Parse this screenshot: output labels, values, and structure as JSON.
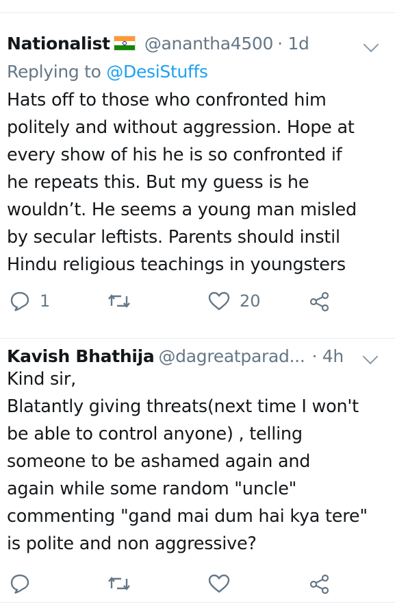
{
  "tweets": [
    {
      "name": "Nationalist",
      "flag": "india-flag-icon",
      "handle": "@anantha4500",
      "time": "· 1d",
      "replying_prefix": "Replying to ",
      "replying_to": "@DesiStuffs",
      "lines": [
        "Hats off to those who confronted him",
        "politely and without aggression. Hope at",
        "every show of his he is so confronted if",
        "he repeats this. But my guess is he",
        "wouldn’t. He seems a young man misled",
        "by secular leftists. Parents should instil",
        "Hindu religious teachings in youngsters"
      ],
      "reply_count": "1",
      "retweet_count": "",
      "like_count": "20"
    },
    {
      "name": "Kavish Bhathija",
      "handle": "@dagreatparad...",
      "time": "· 4h",
      "lines": [
        "Kind sir,",
        "Blatantly giving threats(next time I won't",
        "be able to control anyone) , telling",
        "someone to be ashamed again and",
        "again while some random \"uncle\"",
        "commenting \"gand mai dum hai kya tere\"",
        "is polite and non aggressive?"
      ],
      "reply_count": "",
      "retweet_count": "",
      "like_count": ""
    }
  ],
  "colors": {
    "text": "#14171a",
    "secondary": "#657786",
    "link": "#1da1f2",
    "divider": "#e6ecf0"
  }
}
